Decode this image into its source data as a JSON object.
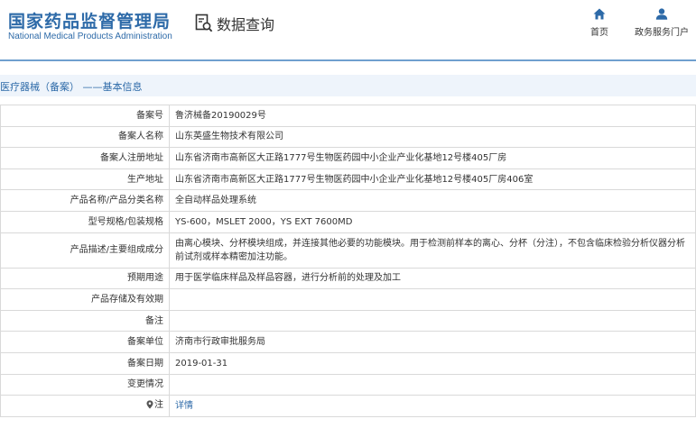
{
  "header": {
    "org_cn": "国家药品监督管理局",
    "org_en": "National Medical Products Administration",
    "query_label": "数据查询",
    "nav": [
      {
        "label": "首页",
        "icon": "home-icon"
      },
      {
        "label": "政务服务门户",
        "icon": "user-icon"
      }
    ]
  },
  "breadcrumb": "医疗器械（备案） ——基本信息",
  "colors": {
    "brand": "#2d6aa8",
    "rule": "#6f9fcf",
    "crumb_bg": "#eef4fb",
    "border": "#d9d9d9"
  },
  "rows": [
    {
      "label": "备案号",
      "value": "鲁济械备20190029号"
    },
    {
      "label": "备案人名称",
      "value": "山东英盛生物技术有限公司"
    },
    {
      "label": "备案人注册地址",
      "value": "山东省济南市高新区大正路1777号生物医药园中小企业产业化基地12号楼405厂房"
    },
    {
      "label": "生产地址",
      "value": "山东省济南市高新区大正路1777号生物医药园中小企业产业化基地12号楼405厂房406室"
    },
    {
      "label": "产品名称/产品分类名称",
      "value": "全自动样品处理系统"
    },
    {
      "label": "型号规格/包装规格",
      "value": "YS-600，MSLET 2000，YS EXT 7600MD"
    },
    {
      "label": "产品描述/主要组成成分",
      "value": "由离心模块、分杯模块组成，并连接其他必要的功能模块。用于检测前样本的离心、分杯（分注），不包含临床检验分析仪器分析前试剂或样本精密加注功能。"
    },
    {
      "label": "预期用途",
      "value": "用于医学临床样品及样品容器，进行分析前的处理及加工"
    },
    {
      "label": "产品存储及有效期",
      "value": ""
    },
    {
      "label": "备注",
      "value": ""
    },
    {
      "label": "备案单位",
      "value": "济南市行政审批服务局"
    },
    {
      "label": "备案日期",
      "value": "2019-01-31"
    },
    {
      "label": "变更情况",
      "value": ""
    },
    {
      "label": "注",
      "value": "详情",
      "icon": "location-pin-icon"
    }
  ]
}
